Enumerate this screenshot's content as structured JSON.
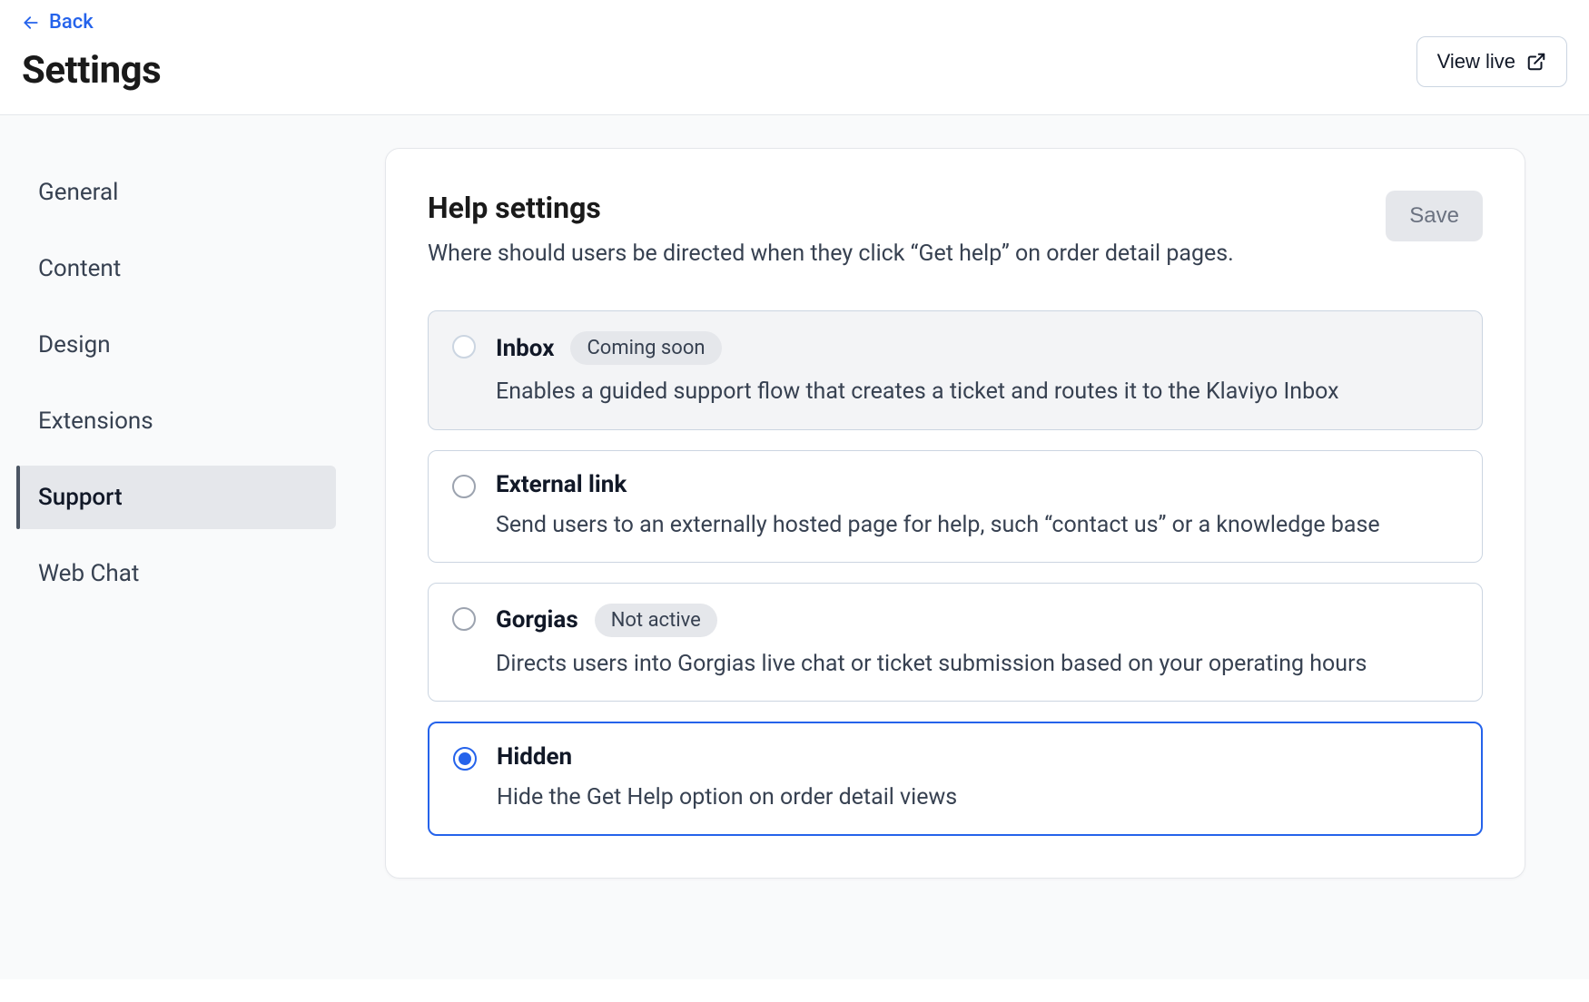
{
  "header": {
    "back_label": "Back",
    "title": "Settings",
    "view_live_label": "View live"
  },
  "sidebar": {
    "items": [
      {
        "label": "General",
        "active": false
      },
      {
        "label": "Content",
        "active": false
      },
      {
        "label": "Design",
        "active": false
      },
      {
        "label": "Extensions",
        "active": false
      },
      {
        "label": "Support",
        "active": true
      },
      {
        "label": "Web Chat",
        "active": false
      }
    ]
  },
  "section": {
    "title": "Help settings",
    "description": "Where should users be directed when they click “Get help” on order detail pages.",
    "save_label": "Save"
  },
  "options": [
    {
      "id": "inbox",
      "title": "Inbox",
      "badge": "Coming soon",
      "description": "Enables a guided support flow that creates a ticket and routes it to the Klaviyo Inbox",
      "disabled": true,
      "selected": false
    },
    {
      "id": "external",
      "title": "External link",
      "badge": null,
      "description": "Send users to an externally hosted page for help, such “contact us” or a knowledge base",
      "disabled": false,
      "selected": false
    },
    {
      "id": "gorgias",
      "title": "Gorgias",
      "badge": "Not active",
      "description": "Directs users into Gorgias live chat or ticket submission based on your operating hours",
      "disabled": false,
      "selected": false
    },
    {
      "id": "hidden",
      "title": "Hidden",
      "badge": null,
      "description": "Hide the Get Help option on order detail views",
      "disabled": false,
      "selected": true
    }
  ]
}
